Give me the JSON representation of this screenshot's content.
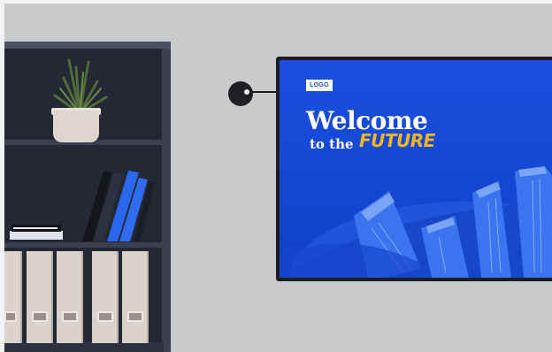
{
  "screen": {
    "logo": "LOGO",
    "headline": "Welcome",
    "subline": "to the",
    "highlight": "FUTURE"
  },
  "colors": {
    "wall": "#c9cacc",
    "bookshelf": "#232833",
    "screen_blue": "#1448d8",
    "accent_yellow": "#f6b51c",
    "binder": "#d9d2cd"
  },
  "icons": {
    "plant": "potted-plant-icon",
    "connector": "wireless-connector-icon"
  }
}
